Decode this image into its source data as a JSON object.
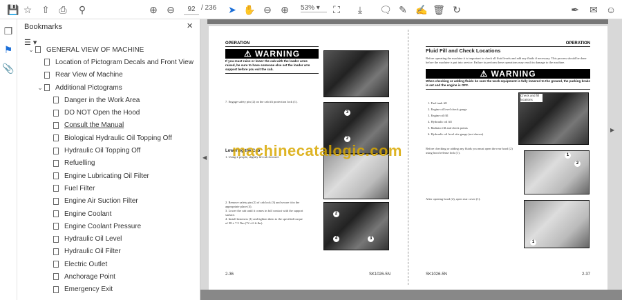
{
  "toolbar": {
    "page_current": "92",
    "page_total": "/ 236",
    "zoom": "53%",
    "icons": [
      "save-icon",
      "bookmark-star-icon",
      "upload-icon",
      "print-icon",
      "search-icon",
      "prev-page-icon",
      "next-page-icon",
      "select-cursor-icon",
      "hand-tool-icon",
      "zoom-out-icon",
      "zoom-in-icon",
      "fit-page-icon",
      "scroll-mode-icon",
      "comment-icon",
      "pen-icon",
      "sign-icon",
      "delete-icon",
      "rotate-icon",
      "fill-sign-icon",
      "email-icon",
      "account-icon"
    ]
  },
  "sidebar": {
    "title": "Bookmarks",
    "items": [
      {
        "label": "GENERAL VIEW OF MACHINE",
        "level": 0,
        "expanded": true
      },
      {
        "label": "Location of Pictogram Decals and Front View",
        "level": 1
      },
      {
        "label": "Rear View of Machine",
        "level": 1
      },
      {
        "label": "Additional Pictograms",
        "level": 1,
        "expanded": true
      },
      {
        "label": "Danger in the Work Area",
        "level": 2
      },
      {
        "label": "DO NOT Open the Hood",
        "level": 2
      },
      {
        "label": "Consult the Manual",
        "level": 2
      },
      {
        "label": "Biological Hydraulic Oil Topping Off",
        "level": 2
      },
      {
        "label": "Hydraulic Oil Topping Off",
        "level": 2
      },
      {
        "label": "Refuelling",
        "level": 2
      },
      {
        "label": "Engine Lubricating Oil Filter",
        "level": 2
      },
      {
        "label": "Fuel Filter",
        "level": 2
      },
      {
        "label": "Engine Air Suction Filter",
        "level": 2
      },
      {
        "label": "Engine Coolant",
        "level": 2
      },
      {
        "label": "Engine Coolant Pressure",
        "level": 2
      },
      {
        "label": "Hydraulic Oil Level",
        "level": 2
      },
      {
        "label": "Hydraulic Oil Filter",
        "level": 2
      },
      {
        "label": "Electric Outlet",
        "level": 2
      },
      {
        "label": "Anchorage Point",
        "level": 2
      },
      {
        "label": "Emergency Exit",
        "level": 2
      }
    ]
  },
  "left_page": {
    "header": "OPERATION",
    "warning": "WARNING",
    "warning_text": "If you must raise or lower the cab with the loader arms raised, be sure to have someone else set the loader arm support before you exit the cab.",
    "step7": "7.   Engage safety pin (2) on the cab tilt protection lock (1).",
    "section": "Lowering the Cab",
    "step1": "1.   Using 2 people, slightly lift cab forward.",
    "steps": [
      "2.   Remove safety pin (2) of cab lock (3) and secure it in the appropriate place (4).",
      "3.   Lower the cab until it comes in full contact with the support surface.",
      "4.   Install fasteners (1) and tighten them to the specified torque of 98 ± 7.5 Nm (72 ± 6 ft.lbs)."
    ],
    "page_no": "2-36",
    "model": "SK1026-5N"
  },
  "right_page": {
    "header": "OPERATION",
    "title": "Fluid Fill and Check Locations",
    "intro": "Before operating the machine it is important to check all fluid levels and add any fluids if necessary. This process should be done before the machine is put into service. Failure to perform these operations may result in damage to the machine.",
    "warning": "WARNING",
    "warning_text": "When checking or adding fluids be sure the work equipment is fully lowered to the ground, the parking brake is set and the engine is OFF.",
    "list": [
      "1.   Fuel tank fill",
      "2.   Engine oil level check gauge",
      "3.   Engine oil fill",
      "4.   Hydraulic oil fill",
      "5.   Radiator fill and check points",
      "6.   Hydraulic oil level site gauge (not shown)"
    ],
    "image_label": "Check and fill locations",
    "hood_text": "Before checking or adding any fluids you must open the rear hood (2) using hood release lock (1).",
    "cover_text": "After opening hood (2), open rear cover (1).",
    "page_no": "2-37",
    "model": "SK1026-5N"
  },
  "watermark": "machinecatalogic.com"
}
